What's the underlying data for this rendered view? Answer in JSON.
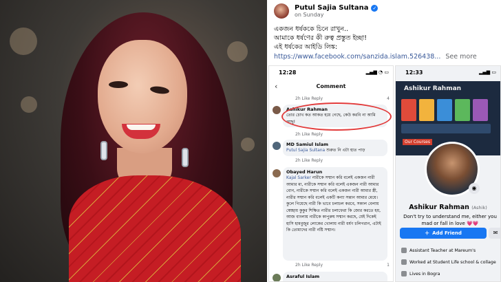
{
  "post": {
    "author": "Putul Sajia Sultana",
    "time": "on Sunday",
    "lines": [
      "একজন ধর্ষককে চিনে রাখুন..",
      "আমাকে ধর্ষণের কী রুত্ব প্রস্তুত ইচ্ছা!",
      "এই ধর্ষকের আইডি লিঙ্ক:"
    ],
    "link": "https://www.facebook.com/sanzida.islam.526438...",
    "see_more": "See more"
  },
  "comments_screen": {
    "status_time": "12:28",
    "title": "Comment",
    "meta_top": "2h   Like   Reply",
    "comments": [
      {
        "name": "Ashikur Rahman",
        "text": "তোর চোখ কত আকত হয়ে গেছে, কেউ করবি না আমি আছু!",
        "meta": "2h   Like   Reply"
      },
      {
        "name": "MD Samiul Islam",
        "tag": "Putul Sajia Sultana",
        "text": " শুরুত নি এটা হাত পাড়",
        "meta": "2h   Like   Reply"
      },
      {
        "name": "Obayed Harun",
        "tag": "Kajal Sarker",
        "text": " নারীকে সম্মান করি বলেই একজন নারী আমার মা, নারীকে সম্মান করি বলেই একজন নারী আমার বোন, নারীকে সম্মান করি বলেই একজন নারী আমার স্ত্রী, নারীর সম্মান করি বলেই একটি কন্যা সন্তান আমার মেয়ে। কুলে গিয়েছে নারী কি ভাবে চলাচল করবে, সকাল বেলায় স্বেচ্ছায় কুকুর শিক্ষিত নারীর চলাফেরা কি জোর করতে হয়, আজ বাংলায় নারীকে কাপুরুষ সম্মান করছে, যেই দিকেই হাসি হামবুজুর লোকের খোলায় নারী ধর্ষণ চলিগরান, এটাই কি তোমাদের নারী নষ্টি সম্মান।",
        "meta": "2h   Like   Reply",
        "reactions": "1"
      },
      {
        "name": "Asraful Islam",
        "text": "",
        "meta": ""
      }
    ],
    "top_reactions": "4"
  },
  "profile_screen": {
    "status_time": "12:33",
    "cover_name": "Ashikur Rahman",
    "cover_label": "Our Courses",
    "name": "Ashikur Rahman",
    "nickname": "(Ashik)",
    "bio": "Don't try to understand me, either you mad or fall in love 💗💗",
    "add_friend_label": "Add Friend",
    "info": [
      {
        "icon": "briefcase-icon",
        "text": "Assistant Teacher at Mareum's"
      },
      {
        "icon": "briefcase-icon",
        "text": "Worked at Student Life school & collage"
      },
      {
        "icon": "home-icon",
        "text": "Lives in Bogra"
      }
    ]
  },
  "colors": {
    "fb_blue": "#1877f2",
    "link_blue": "#385898",
    "highlight_red": "#e23a3a"
  }
}
